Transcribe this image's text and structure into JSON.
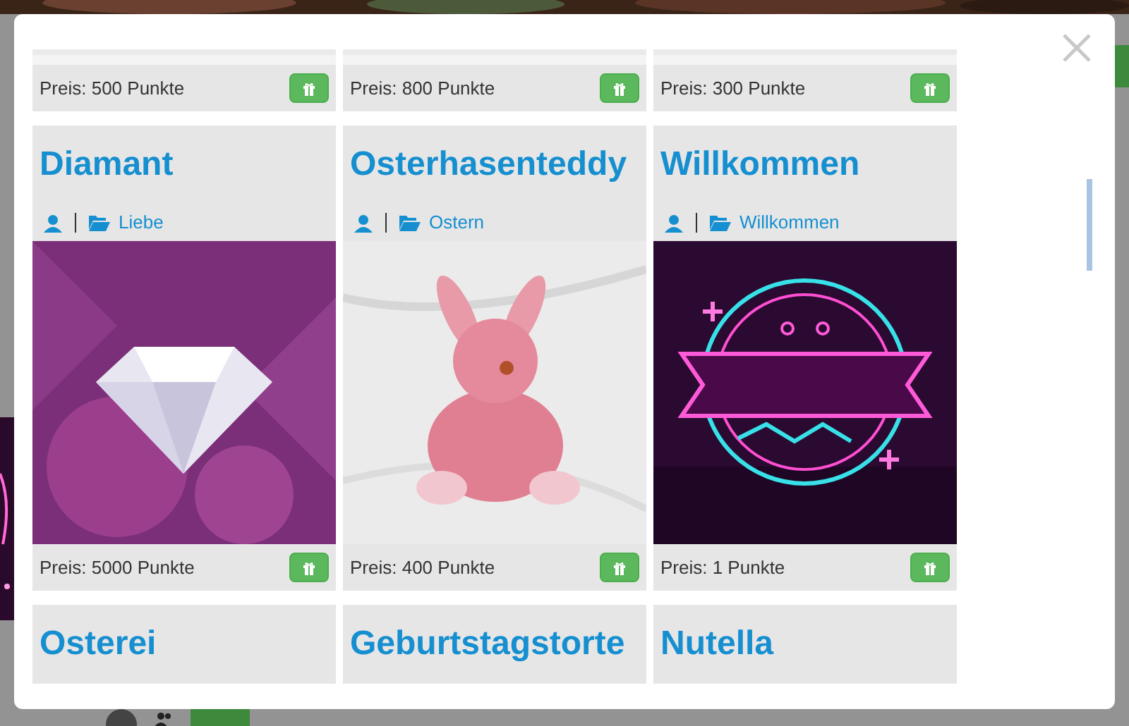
{
  "gifts": [
    {
      "kind": "price_only",
      "price": "Preis: 500 Punkte"
    },
    {
      "kind": "price_only",
      "price": "Preis: 800 Punkte"
    },
    {
      "kind": "price_only",
      "price": "Preis: 300 Punkte"
    },
    {
      "kind": "full",
      "title": "Diamant",
      "category": "Liebe",
      "price": "Preis: 5000 Punkte"
    },
    {
      "kind": "full",
      "title": "Osterhasenteddy",
      "category": "Ostern",
      "price": "Preis: 400 Punkte"
    },
    {
      "kind": "full",
      "title": "Willkommen",
      "category": "Willkommen",
      "price": "Preis: 1 Punkte"
    },
    {
      "kind": "title_only",
      "title": "Osterei"
    },
    {
      "kind": "title_only",
      "title": "Geburtstagstorte"
    },
    {
      "kind": "title_only",
      "title": "Nutella"
    }
  ]
}
